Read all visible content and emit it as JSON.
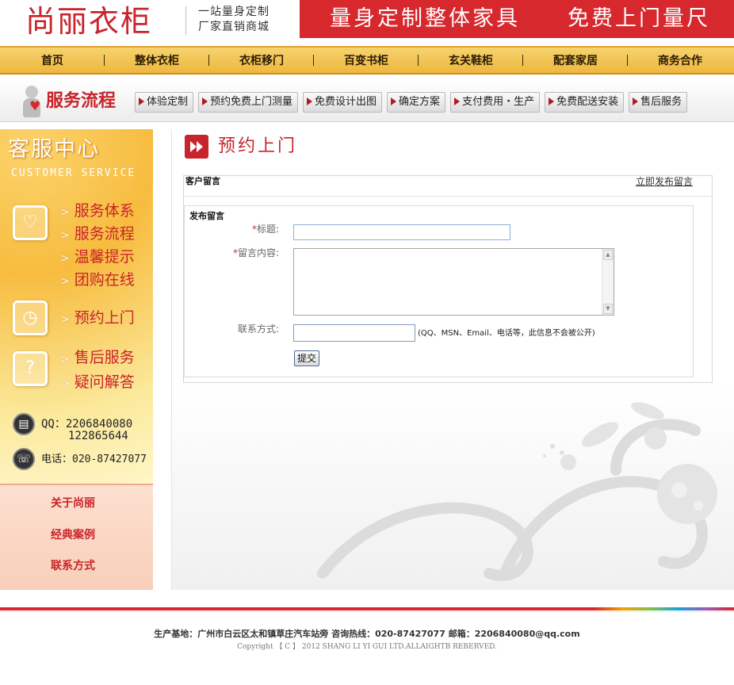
{
  "header": {
    "logo_text": "尚丽衣柜",
    "slogan_line1": "一站量身定制",
    "slogan_line2": "厂家直销商城",
    "banner_left": "量身定制整体家具",
    "banner_right": "免费上门量尺",
    "banner_color": "#d7282e"
  },
  "nav": {
    "items": [
      {
        "label": "首页"
      },
      {
        "label": "整体衣柜"
      },
      {
        "label": "衣柜移门"
      },
      {
        "label": "百变书柜"
      },
      {
        "label": "玄关鞋柜"
      },
      {
        "label": "配套家居"
      },
      {
        "label": "商务合作"
      }
    ]
  },
  "process": {
    "title": "服务流程",
    "icon": "person-heart-icon",
    "steps": [
      {
        "label": "体验定制"
      },
      {
        "label": "预约免费上门测量"
      },
      {
        "label": "免费设计出图"
      },
      {
        "label": "确定方案"
      },
      {
        "label": "支付费用・生产"
      },
      {
        "label": "免费配送安装"
      },
      {
        "label": "售后服务"
      }
    ]
  },
  "sidebar": {
    "title": "客服中心",
    "subtitle": "CUSTOMER SERVICE",
    "group1": {
      "icon": "heart-icon",
      "links": [
        "服务体系",
        "服务流程",
        "温馨提示",
        "团购在线"
      ]
    },
    "group2": {
      "icon": "clock-icon",
      "links": [
        "预约上门"
      ]
    },
    "group3": {
      "icon": "question-icon",
      "links": [
        "售后服务",
        "疑问解答"
      ]
    },
    "qq_line1": "QQ：2206840080",
    "qq_line2": "122865644",
    "phone": "电话：020-87427077",
    "bottom_links": [
      "关于尚丽",
      "经典案例",
      "联系方式"
    ]
  },
  "main": {
    "title": "预约上门",
    "panel_title": "客户留言",
    "panel_link": "立即发布留言",
    "form_title": "发布留言",
    "required_mark": "*",
    "field_title_label": "标题:",
    "field_content_label": "留言内容:",
    "field_contact_label": "联系方式:",
    "contact_hint": "(QQ、MSN、Email、电话等，此信息不会被公开)",
    "title_value": "",
    "content_value": "",
    "contact_value": "",
    "submit_label": "提交"
  },
  "footer": {
    "line1": "生产基地：广州市白云区太和镇草庄汽车站旁   咨询热线：020-87427077  邮箱：2206840080@qq.com",
    "line2": "Copyright 【 C 】 2012 SHANG LI YI GUI  LTD.ALLAIGHTB REBERVED."
  }
}
